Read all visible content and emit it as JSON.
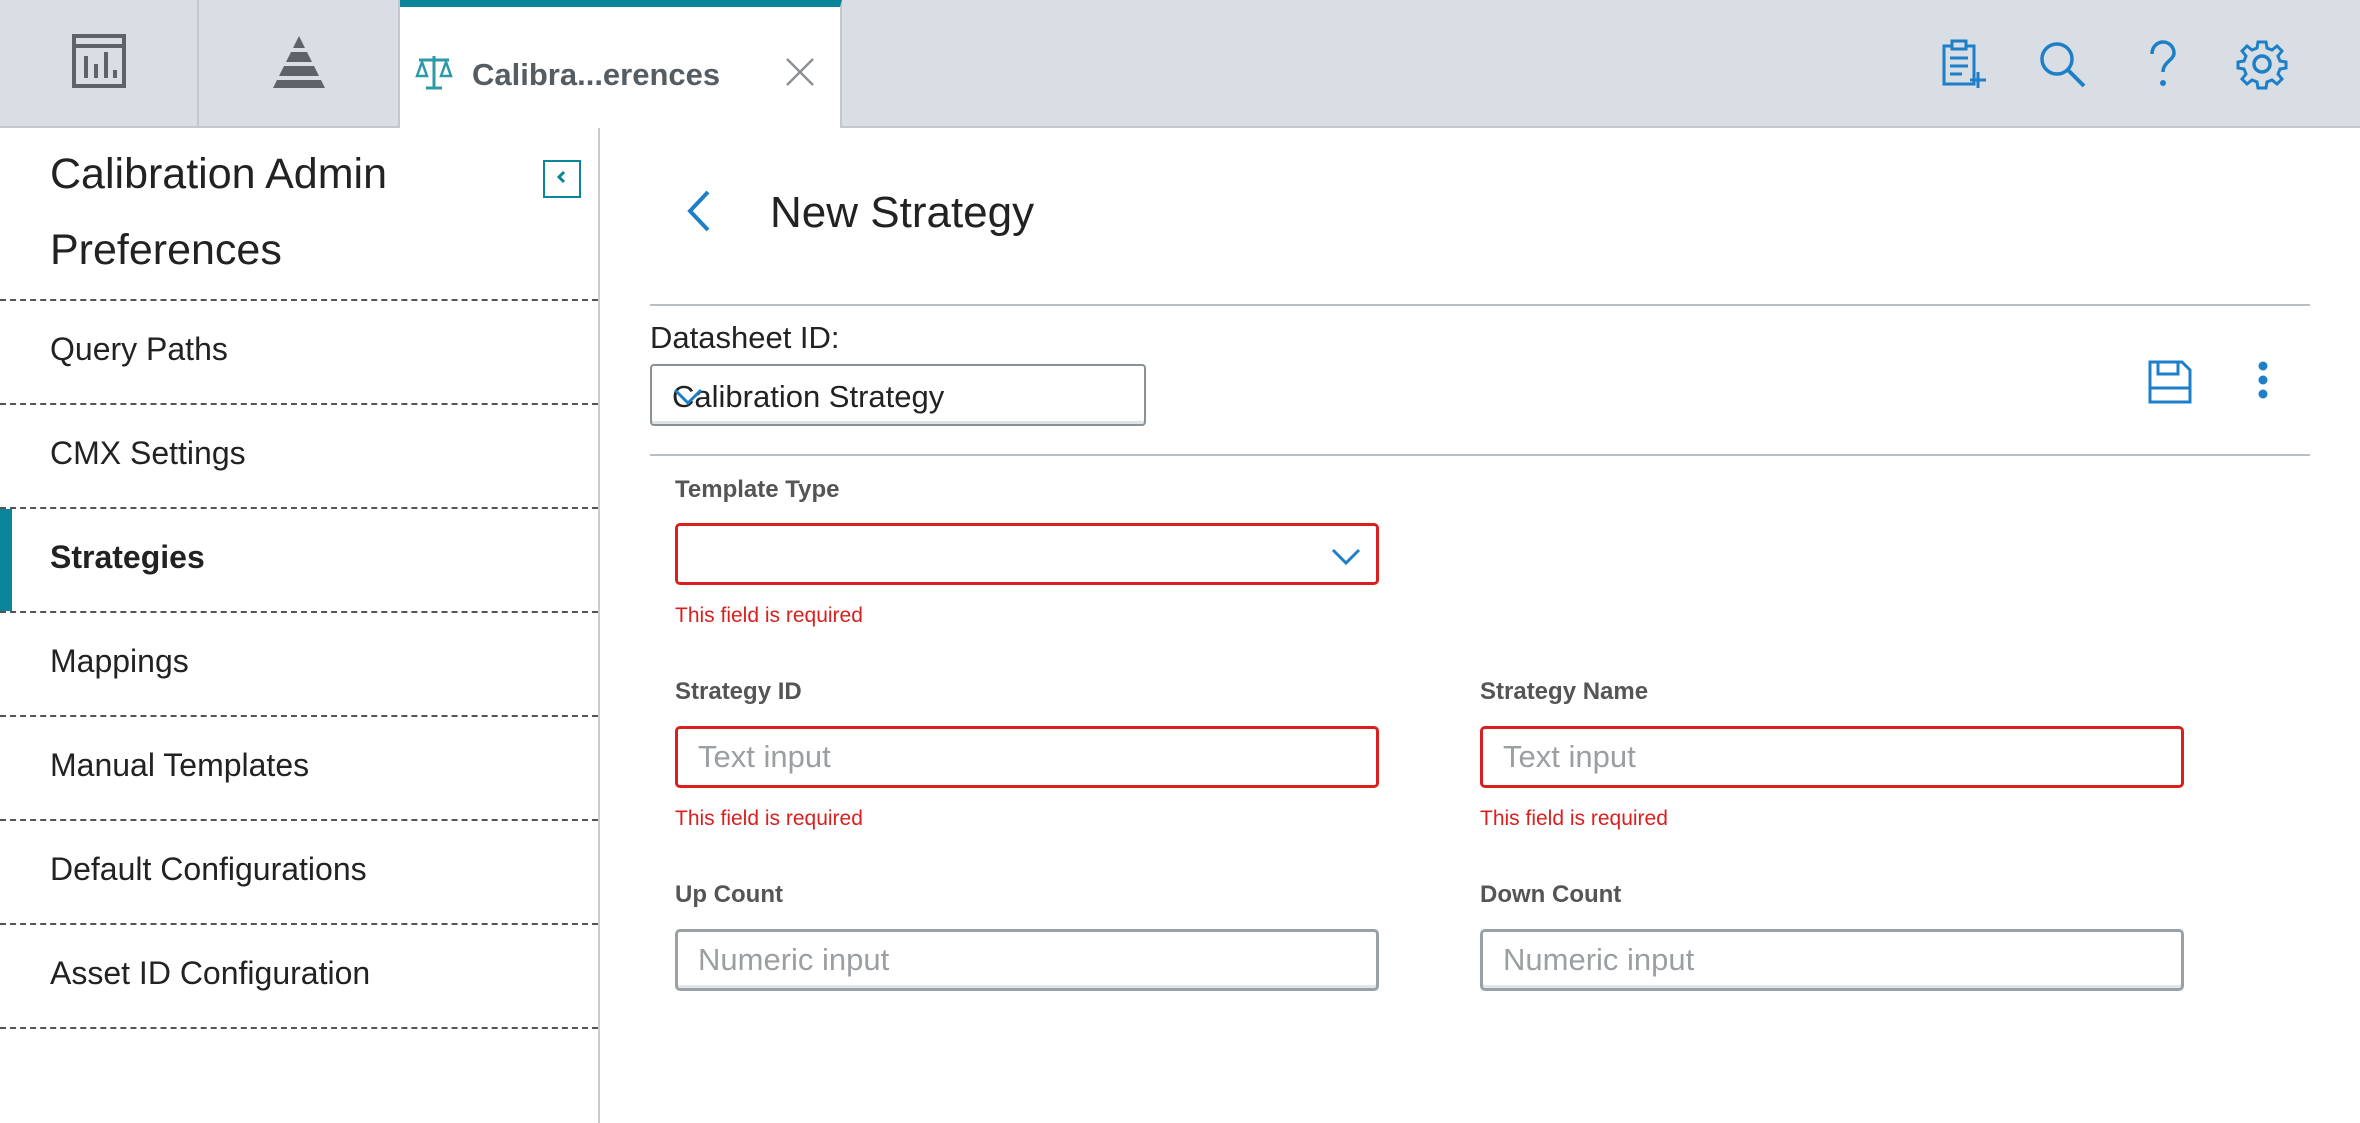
{
  "topbar": {
    "tab": {
      "label": "Calibra...erences"
    },
    "icons": [
      "dashboard-icon",
      "pyramid-icon",
      "scale-icon",
      "close-icon",
      "add-clipboard-icon",
      "search-icon",
      "help-icon",
      "gear-icon"
    ]
  },
  "sidebar": {
    "title": "Calibration Admin Preferences",
    "items": [
      {
        "label": "Query Paths",
        "active": false
      },
      {
        "label": "CMX Settings",
        "active": false
      },
      {
        "label": "Strategies",
        "active": true
      },
      {
        "label": "Mappings",
        "active": false
      },
      {
        "label": "Manual Templates",
        "active": false
      },
      {
        "label": "Default Configurations",
        "active": false
      },
      {
        "label": "Asset ID Configuration",
        "active": false
      }
    ]
  },
  "main": {
    "title": "New Strategy",
    "datasheet": {
      "label": "Datasheet ID:",
      "value": "Calibration Strategy"
    },
    "form": {
      "template_type": {
        "label": "Template Type",
        "value": "",
        "error": "This field is required"
      },
      "strategy_id": {
        "label": "Strategy ID",
        "placeholder": "Text input",
        "error": "This field is required"
      },
      "strategy_name": {
        "label": "Strategy Name",
        "placeholder": "Text input",
        "error": "This field is required"
      },
      "up_count": {
        "label": "Up Count",
        "placeholder": "Numeric input"
      },
      "down_count": {
        "label": "Down Count",
        "placeholder": "Numeric input"
      }
    }
  },
  "colors": {
    "accent": "#0b8599",
    "icon_blue": "#1e7fc9",
    "error": "#d9201e",
    "topbar_bg": "#d8dee3"
  }
}
